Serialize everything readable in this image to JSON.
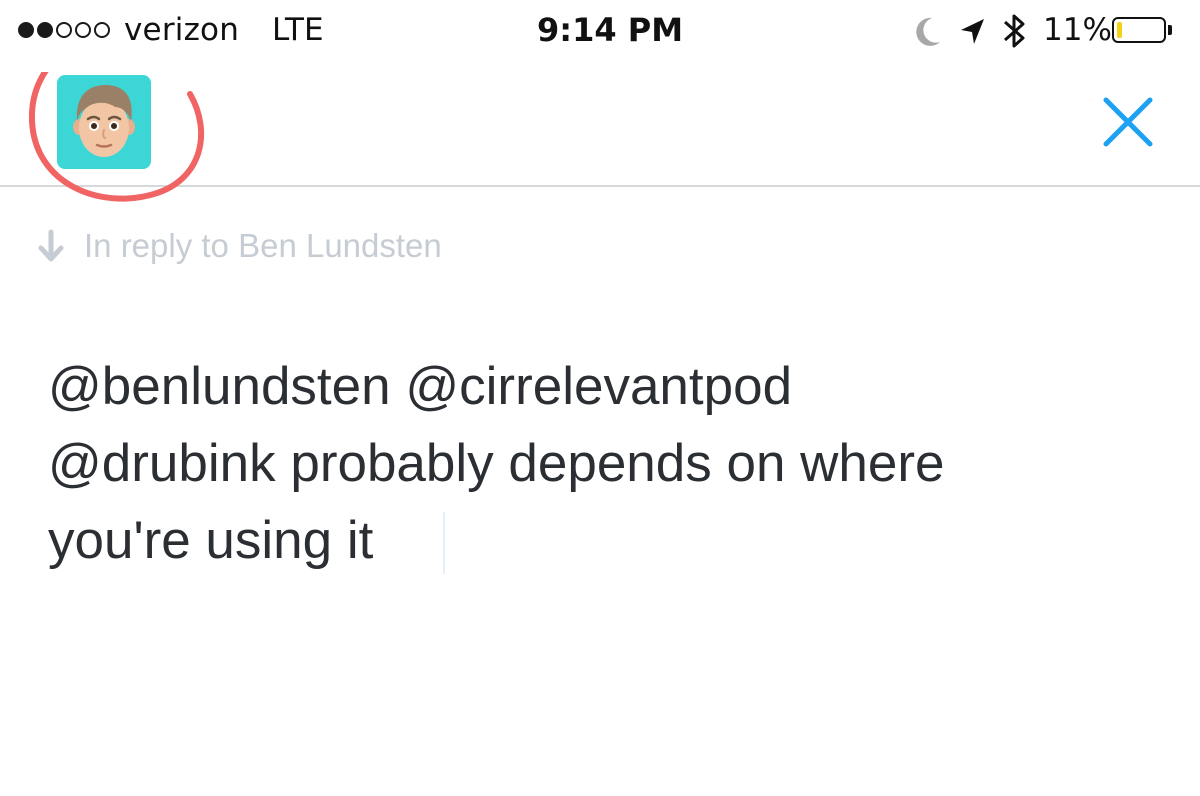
{
  "status_bar": {
    "carrier": "verizon",
    "network": "LTE",
    "time": "9:14 PM",
    "battery_percent": "11%",
    "battery_level": 0.11,
    "signal_bars_filled": 2,
    "signal_bars_total": 5,
    "icons": [
      "moon-icon",
      "location-arrow-icon",
      "bluetooth-icon"
    ]
  },
  "header": {
    "avatar_icon": "memoji-avatar-icon",
    "close_icon": "close-icon",
    "accent_color": "#1da1f2",
    "annotation_color": "#f06464"
  },
  "reply": {
    "text": "In reply to Ben Lundsten"
  },
  "compose": {
    "line1": "@benlundsten @cirrelevantpod",
    "line2": "@drubink probably depends on where",
    "line3": "you're using it"
  }
}
